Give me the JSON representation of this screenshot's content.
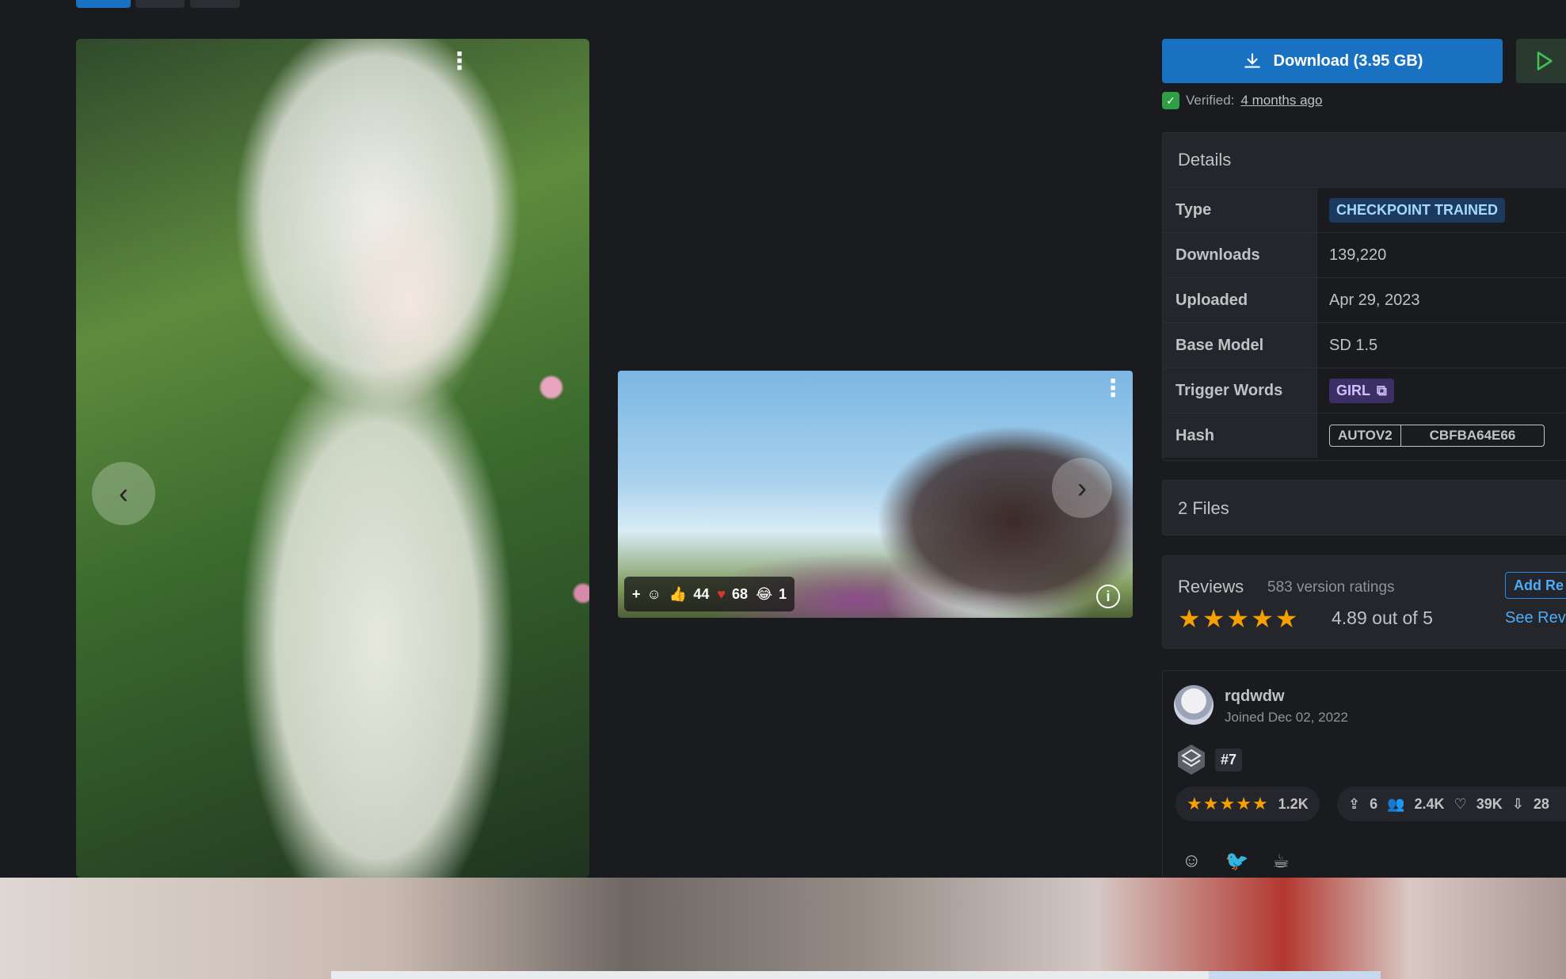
{
  "download": {
    "label": "Download (3.95 GB)"
  },
  "verified": {
    "label": "Verified:",
    "when": "4 months ago"
  },
  "details": {
    "title": "Details",
    "rows": [
      {
        "key": "Type",
        "value": "CHECKPOINT TRAINED"
      },
      {
        "key": "Downloads",
        "value": "139,220"
      },
      {
        "key": "Uploaded",
        "value": "Apr 29, 2023"
      },
      {
        "key": "Base Model",
        "value": "SD 1.5"
      },
      {
        "key": "Trigger Words",
        "value": "GIRL"
      },
      {
        "key": "Hash",
        "algo": "AUTOV2",
        "value": "CBFBA64E66"
      }
    ]
  },
  "files": {
    "label": "2 Files"
  },
  "reviews": {
    "title": "Reviews",
    "count": "583 version ratings",
    "rating": "4.89 out of 5",
    "stars": 5,
    "add_label": "Add Re",
    "see_label": "See Revi"
  },
  "creator": {
    "name": "rqdwdw",
    "joined": "Joined Dec 02, 2022",
    "rank": "#7",
    "rating_count": "1.2K",
    "uploads": "6",
    "followers": "2.4K",
    "likes": "39K",
    "downloads": "28"
  },
  "image2": {
    "reactions": {
      "like": "44",
      "heart": "68",
      "laugh": "1"
    }
  },
  "colors": {
    "background": "#1a1b1e",
    "primary": "#1971c2",
    "star": "#f59f00",
    "verified": "#2f9e44"
  }
}
